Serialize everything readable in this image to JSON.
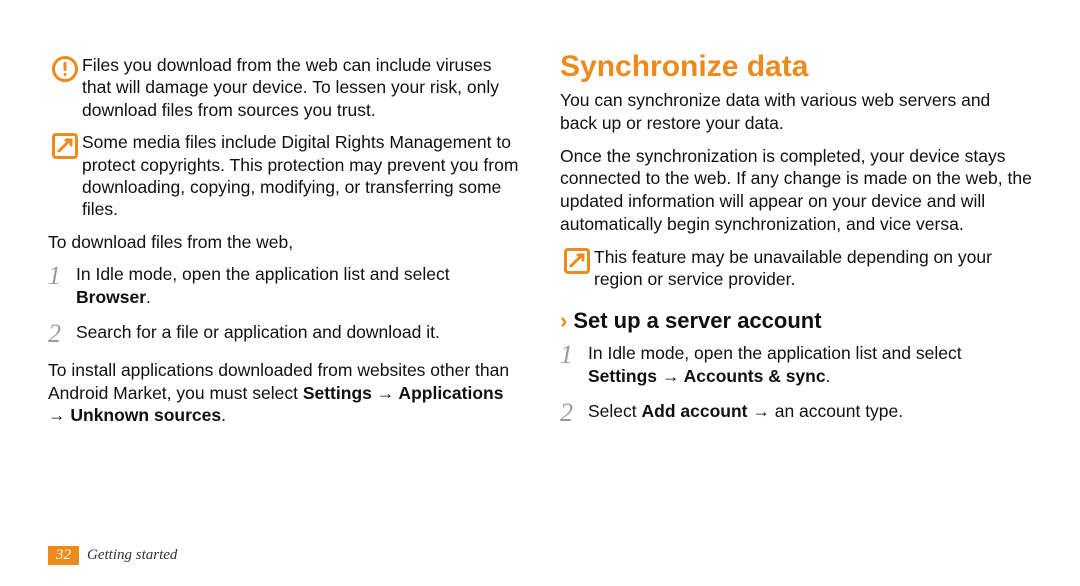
{
  "left": {
    "warn": "Files you download from the web can include viruses that will damage your device. To lessen your risk, only download files from sources you trust.",
    "drm": "Some media files include Digital Rights Management to protect copyrights. This protection may prevent you from downloading, copying, modifying, or transferring some files.",
    "download_intro": "To download files from the web,",
    "step1a": "In Idle mode, open the application list and select ",
    "step1b": "Browser",
    "step1c": ".",
    "step2": "Search for a file or application and download it.",
    "install_a": "To install applications downloaded from websites other than Android Market, you must select ",
    "install_b": "Settings → Applications → Unknown sources",
    "install_c": "."
  },
  "right": {
    "h1": "Synchronize data",
    "p1": "You can synchronize data with various web servers and back up or restore your data.",
    "p2": "Once the synchronization is completed, your device stays connected to the web. If any change is made on the web, the updated information will appear on your device and will automatically begin synchronization, and vice versa.",
    "note": "This feature may be unavailable depending on your region or service provider.",
    "h2": "Set up a server account",
    "s1a": "In Idle mode, open the application list and select ",
    "s1b": "Settings → Accounts & sync",
    "s1c": ".",
    "s2a": "Select ",
    "s2b": "Add account",
    "s2c": " → an account type."
  },
  "nums": {
    "one": "1",
    "two": "2"
  },
  "footer": {
    "page": "32",
    "section": "Getting started"
  },
  "chev": "›"
}
